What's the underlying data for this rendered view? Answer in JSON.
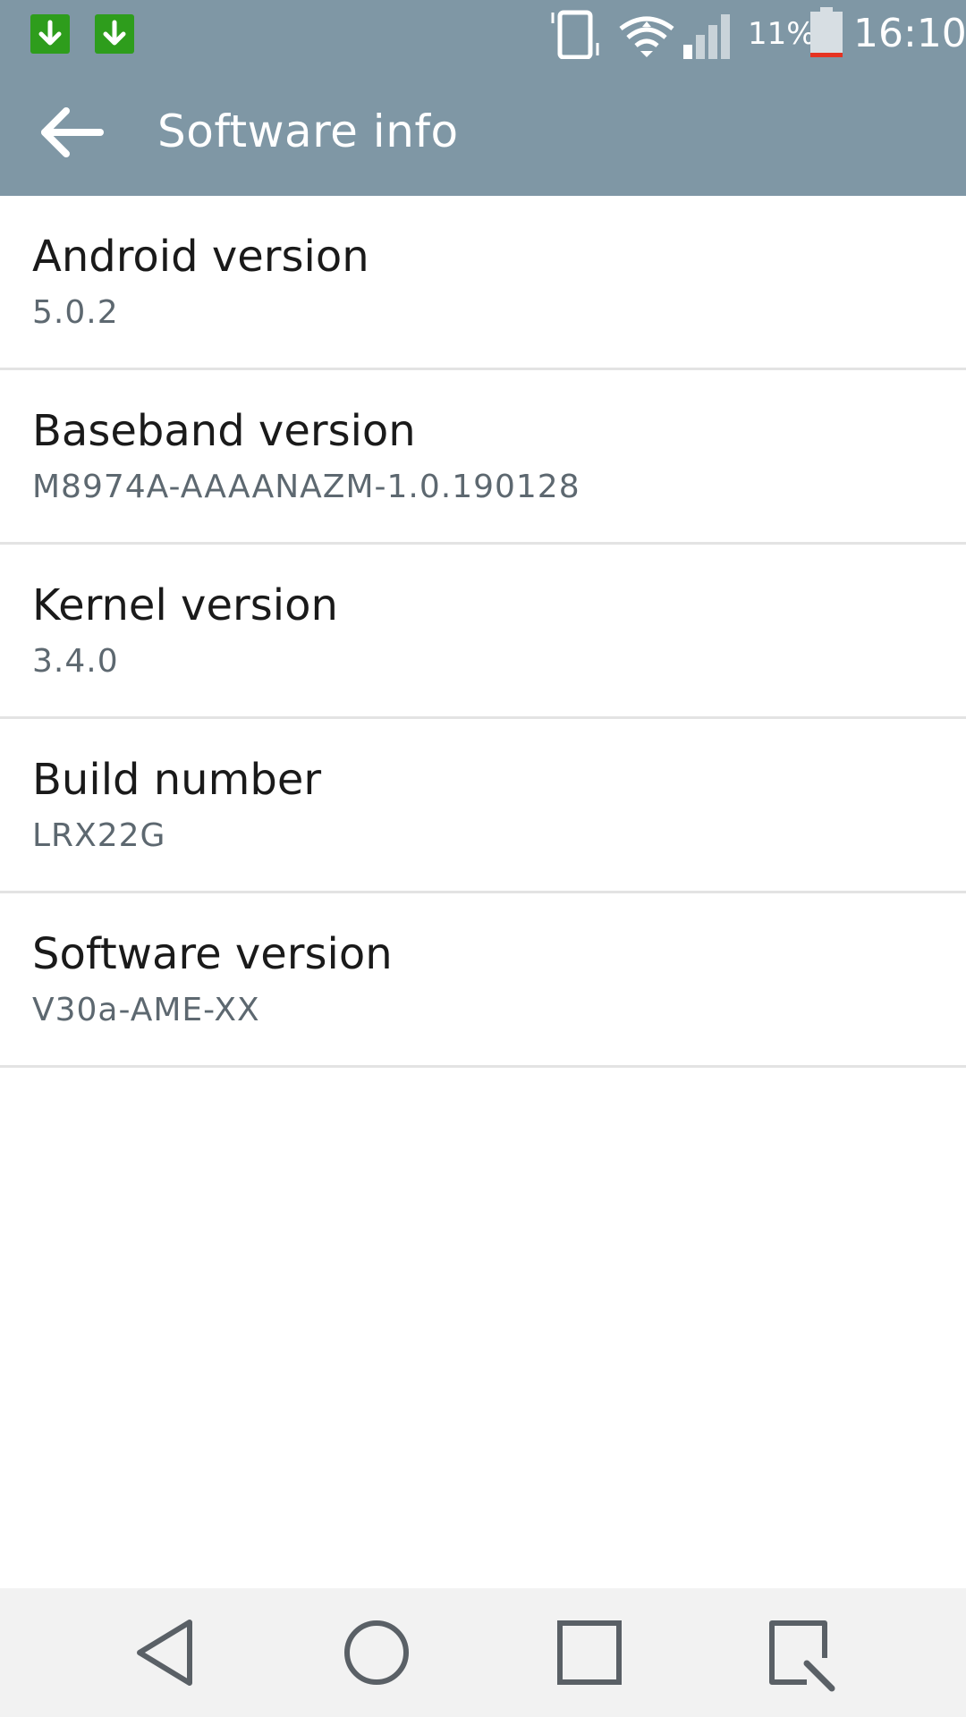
{
  "status_bar": {
    "battery_percent_label": "11%",
    "time": "16:10",
    "icons": [
      "download-icon",
      "download-icon",
      "vibrate-icon",
      "wifi-icon",
      "signal-icon",
      "battery-icon"
    ],
    "colors": {
      "background": "#7f97a5",
      "download_badge": "#2e9d1c",
      "battery_low": "#e53322"
    }
  },
  "action_bar": {
    "title": "Software info",
    "back_icon": "back-arrow-icon"
  },
  "items": [
    {
      "title": "Android version",
      "summary": "5.0.2"
    },
    {
      "title": "Baseband version",
      "summary": "M8974A-AAAANAZM-1.0.190128"
    },
    {
      "title": "Kernel version",
      "summary": "3.4.0"
    },
    {
      "title": "Build number",
      "summary": "LRX22G"
    },
    {
      "title": "Software version",
      "summary": "V30a-AME-XX"
    }
  ],
  "nav_bar": {
    "buttons": [
      "back-nav-icon",
      "home-icon",
      "recents-icon",
      "qslide-icon"
    ]
  }
}
